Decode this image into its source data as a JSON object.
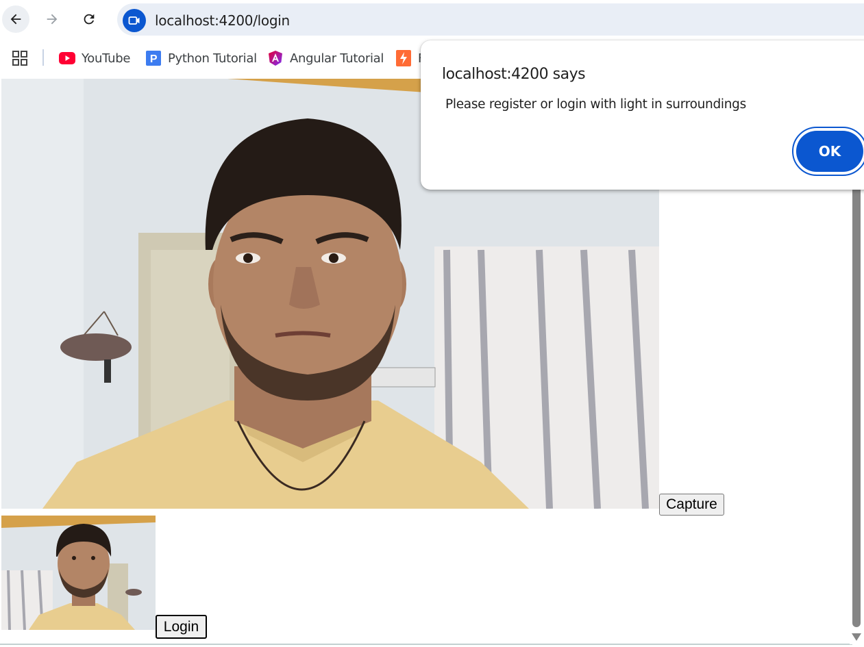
{
  "browser": {
    "url": "localhost:4200/login",
    "bookmarks": [
      {
        "label": "YouTube",
        "icon": "youtube-icon"
      },
      {
        "label": "Python Tutorial",
        "icon": "python-tutorial-icon"
      },
      {
        "label": "Angular Tutorial",
        "icon": "angular-icon"
      },
      {
        "label": "F",
        "icon": "bookmark-icon"
      }
    ]
  },
  "dialog": {
    "title": "localhost:4200 says",
    "message": "Please register or login with light in surroundings",
    "ok_label": "OK"
  },
  "page": {
    "capture_label": "Capture",
    "login_label": "Login"
  },
  "colors": {
    "accent": "#0b57d0",
    "omnibox": "#e9eef6",
    "shirt": "#e8cd8f",
    "wall": "#dfe4e8"
  }
}
